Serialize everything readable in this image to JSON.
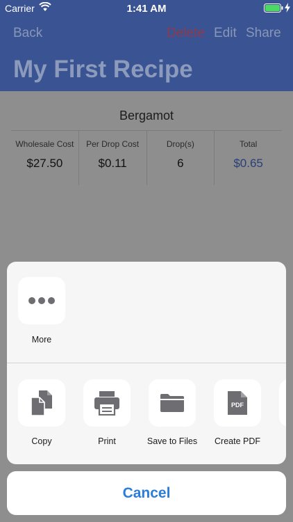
{
  "status": {
    "carrier": "Carrier",
    "time": "1:41 AM"
  },
  "nav": {
    "back": "Back",
    "delete": "Delete",
    "edit": "Edit",
    "share": "Share",
    "title": "My First Recipe"
  },
  "recipe": {
    "oil_name": "Bergamot",
    "columns": [
      {
        "header": "Wholesale Cost",
        "value": "$27.50"
      },
      {
        "header": "Per Drop Cost",
        "value": "$0.11"
      },
      {
        "header": "Drop(s)",
        "value": "6"
      },
      {
        "header": "Total",
        "value": "$0.65"
      }
    ]
  },
  "share_sheet": {
    "row1": [
      {
        "label": "More",
        "icon": "more-icon"
      }
    ],
    "row2": [
      {
        "label": "Copy",
        "icon": "copy-icon"
      },
      {
        "label": "Print",
        "icon": "print-icon"
      },
      {
        "label": "Save to Files",
        "icon": "folder-icon"
      },
      {
        "label": "Create PDF",
        "icon": "pdf-icon",
        "icon_text": "PDF"
      }
    ],
    "cancel": "Cancel"
  },
  "colors": {
    "nav_bar": "#3a5493",
    "accent": "#2a7ed9",
    "delete": "#8c3a4e"
  }
}
